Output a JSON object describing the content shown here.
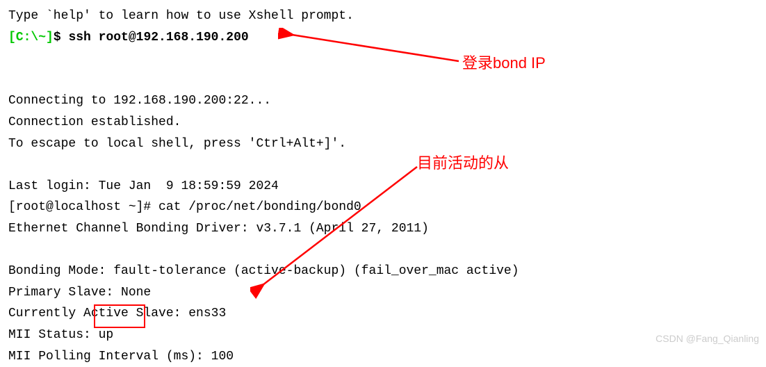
{
  "terminal": {
    "help_line": "Type `help' to learn how to use Xshell prompt.",
    "prompt": "[C:\\~]",
    "dollar": "$",
    "ssh_command": "ssh root@192.168.190.200",
    "blank1": "",
    "connecting": "Connecting to 192.168.190.200:22...",
    "established": "Connection established.",
    "escape": "To escape to local shell, press 'Ctrl+Alt+]'.",
    "blank2": "",
    "last_login": "Last login: Tue Jan  9 18:59:59 2024",
    "root_prompt": "[root@localhost ~]# cat /proc/net/bonding/bond0",
    "driver": "Ethernet Channel Bonding Driver: v3.7.1 (April 27, 2011)",
    "blank3": "",
    "mode": "Bonding Mode: fault-tolerance (active-backup) (fail_over_mac active)",
    "primary": "Primary Slave: None",
    "current_slave": "Currently Active Slave: ens33",
    "mii_status": "MII Status: up",
    "mii_polling": "MII Polling Interval (ms): 100"
  },
  "annotations": {
    "login_label": "登录bond IP",
    "active_slave_label": "目前活动的从"
  },
  "watermark": "CSDN @Fang_Qianling"
}
